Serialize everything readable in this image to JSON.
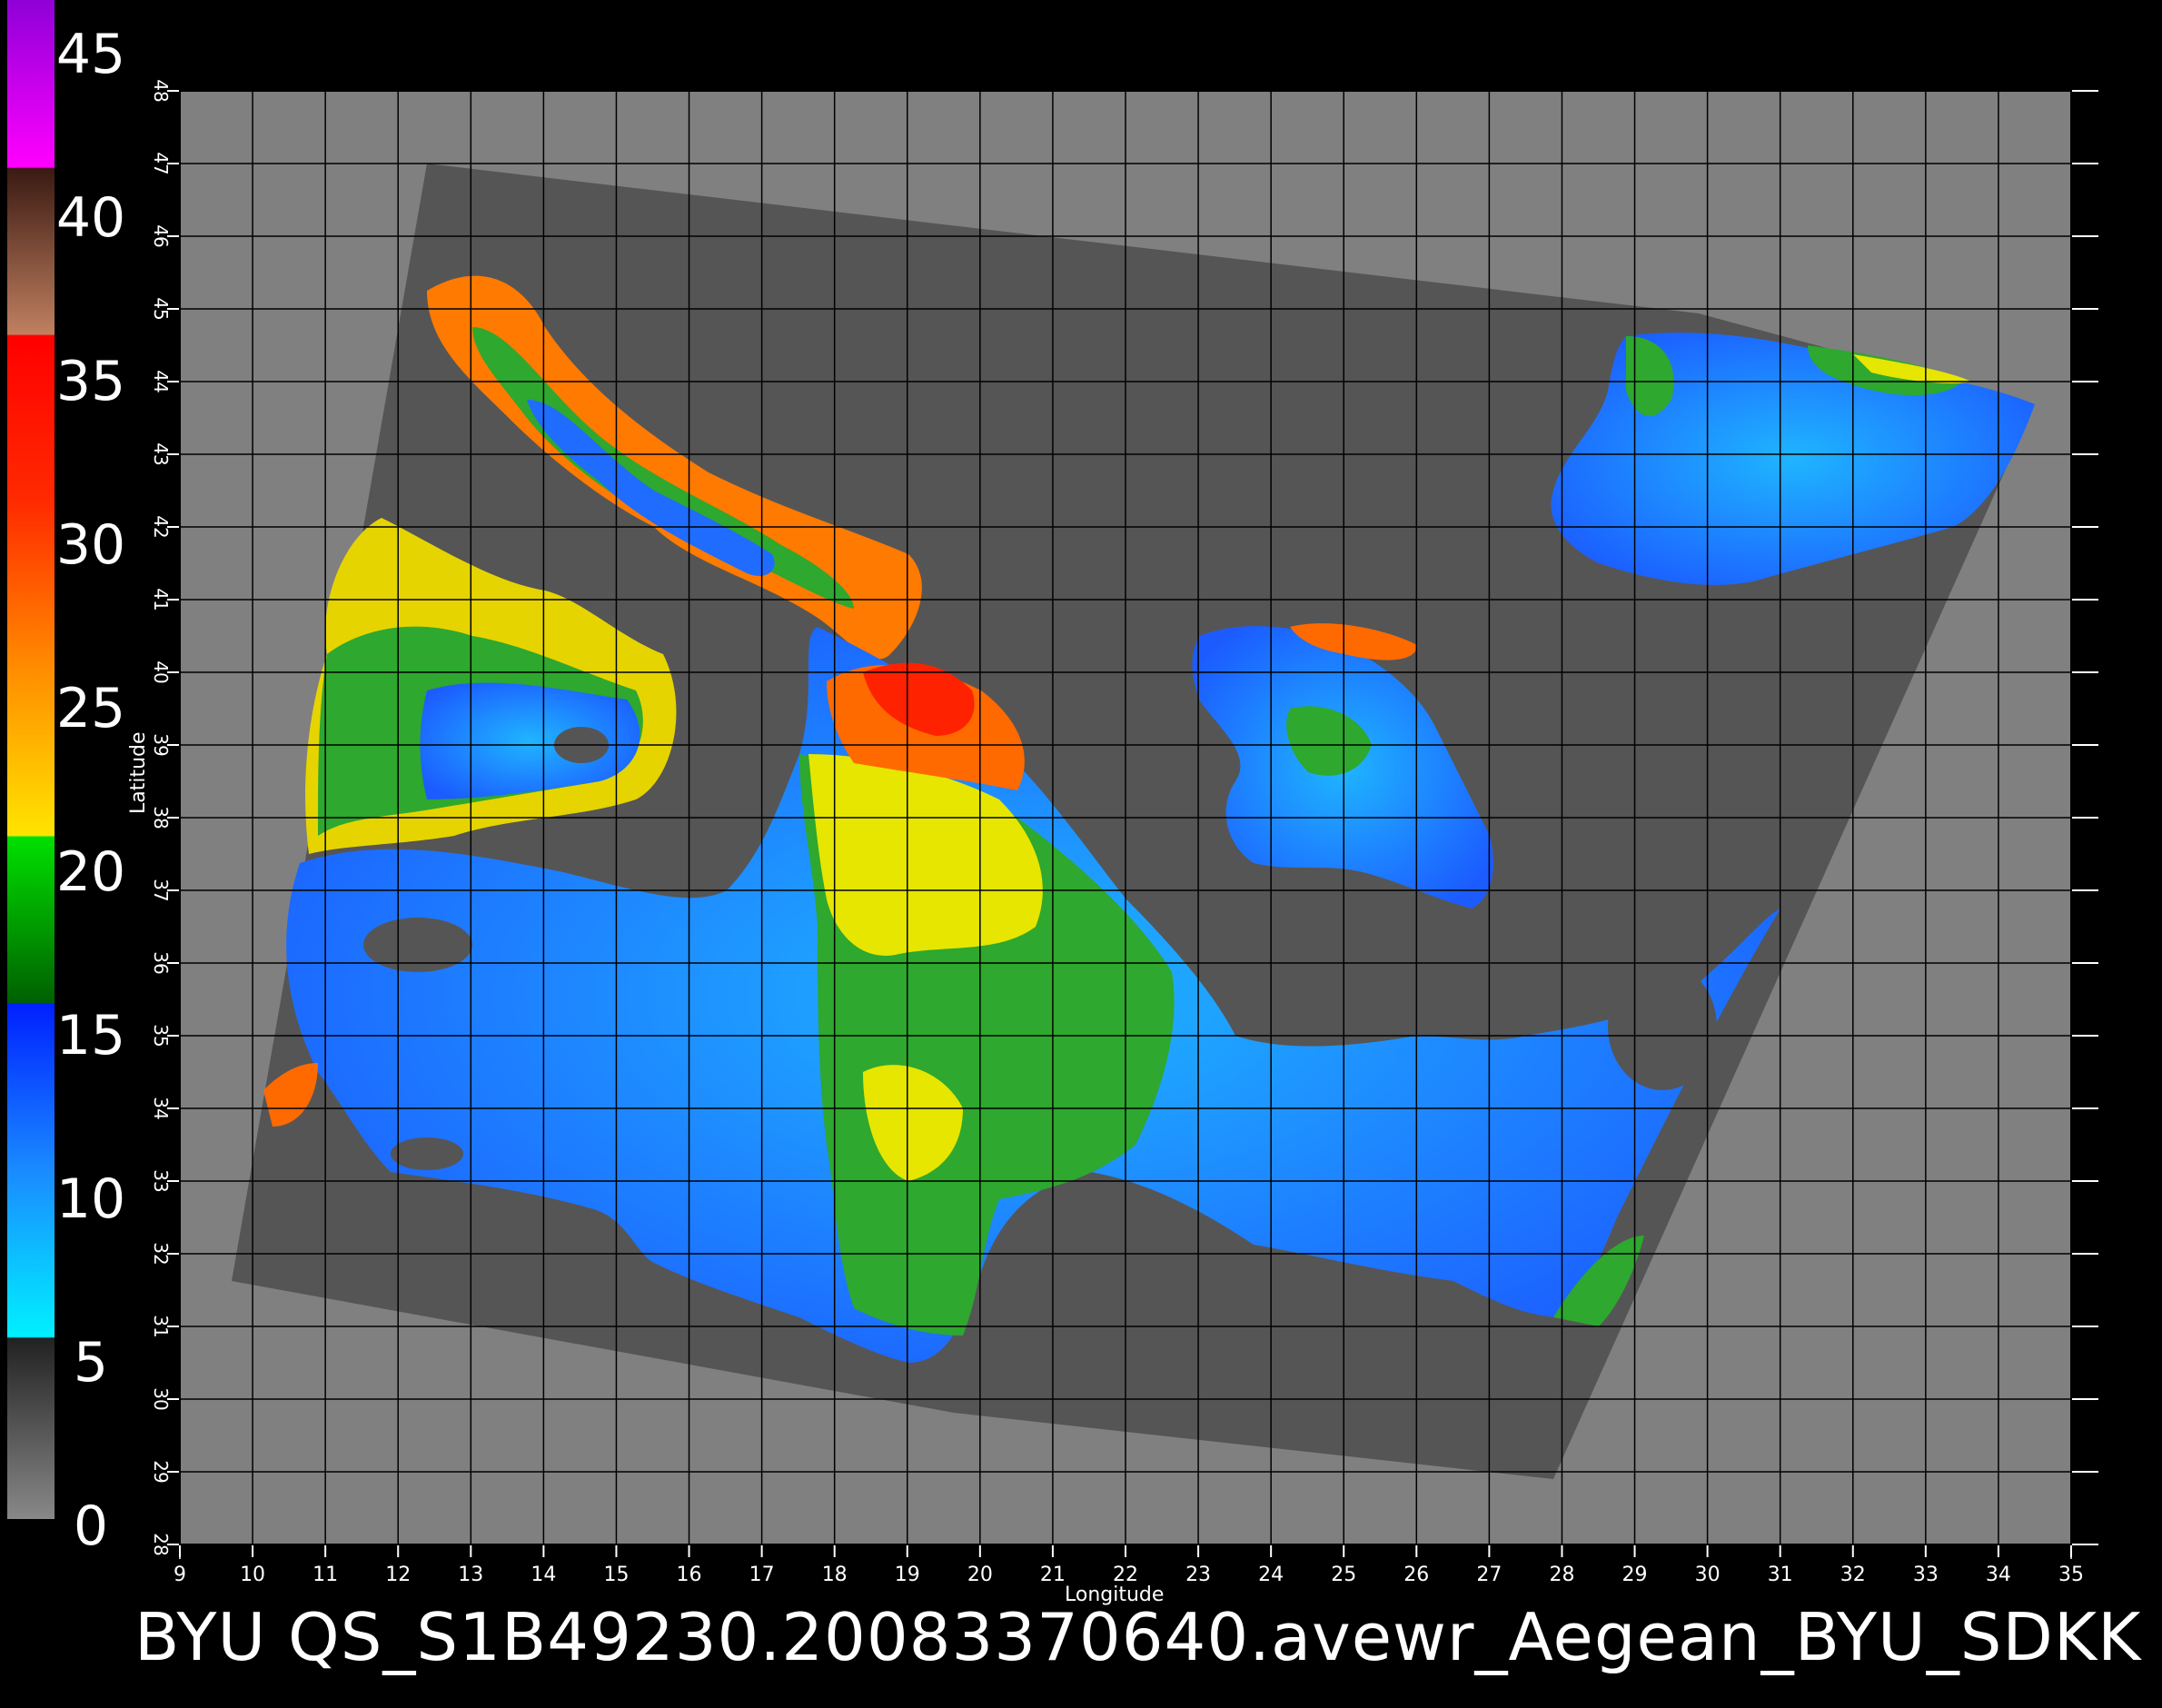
{
  "footer_title": "BYU  QS_S1B49230.20083370640.avewr_Aegean_BYU_SDKK",
  "axes": {
    "x_label": "Longitude",
    "y_label": "Latitude",
    "x_ticks": [
      "9",
      "10",
      "11",
      "12",
      "13",
      "14",
      "15",
      "16",
      "17",
      "18",
      "19",
      "20",
      "21",
      "22",
      "23",
      "24",
      "25",
      "26",
      "27",
      "28",
      "29",
      "30",
      "31",
      "32",
      "33",
      "34",
      "35"
    ],
    "y_ticks": [
      "28",
      "29",
      "30",
      "31",
      "32",
      "33",
      "34",
      "35",
      "36",
      "37",
      "38",
      "39",
      "40",
      "41",
      "42",
      "43",
      "44",
      "45",
      "46",
      "47",
      "48"
    ]
  },
  "colorbar": {
    "labels": [
      "45",
      "40",
      "35",
      "30",
      "25",
      "20",
      "15",
      "10",
      "5",
      "0"
    ],
    "stops": [
      "#8f00d7",
      "#ff00ff",
      "#3a1a12",
      "#c08060",
      "#ff0000",
      "#ff6a00",
      "#ffd700",
      "#00c000",
      "#0030ff",
      "#00e8ff",
      "#555555",
      "#808080"
    ]
  },
  "colors": {
    "background": "#000000",
    "plot_bg": "#808080",
    "swath": "#555555",
    "sea_blue": "#1f6cff",
    "sea_cyan": "#1fb5ff",
    "mid_green": "#2ea82e",
    "yellow": "#e6e600",
    "orange": "#ff6a00",
    "red": "#ff2200",
    "gridline": "#000000"
  },
  "chart_data": {
    "type": "heatmap",
    "title": "",
    "xlabel": "Longitude",
    "ylabel": "Latitude",
    "xlim": [
      9,
      35
    ],
    "ylim": [
      28,
      48
    ],
    "grid": true,
    "colorbar_range": [
      0,
      45
    ]
  }
}
